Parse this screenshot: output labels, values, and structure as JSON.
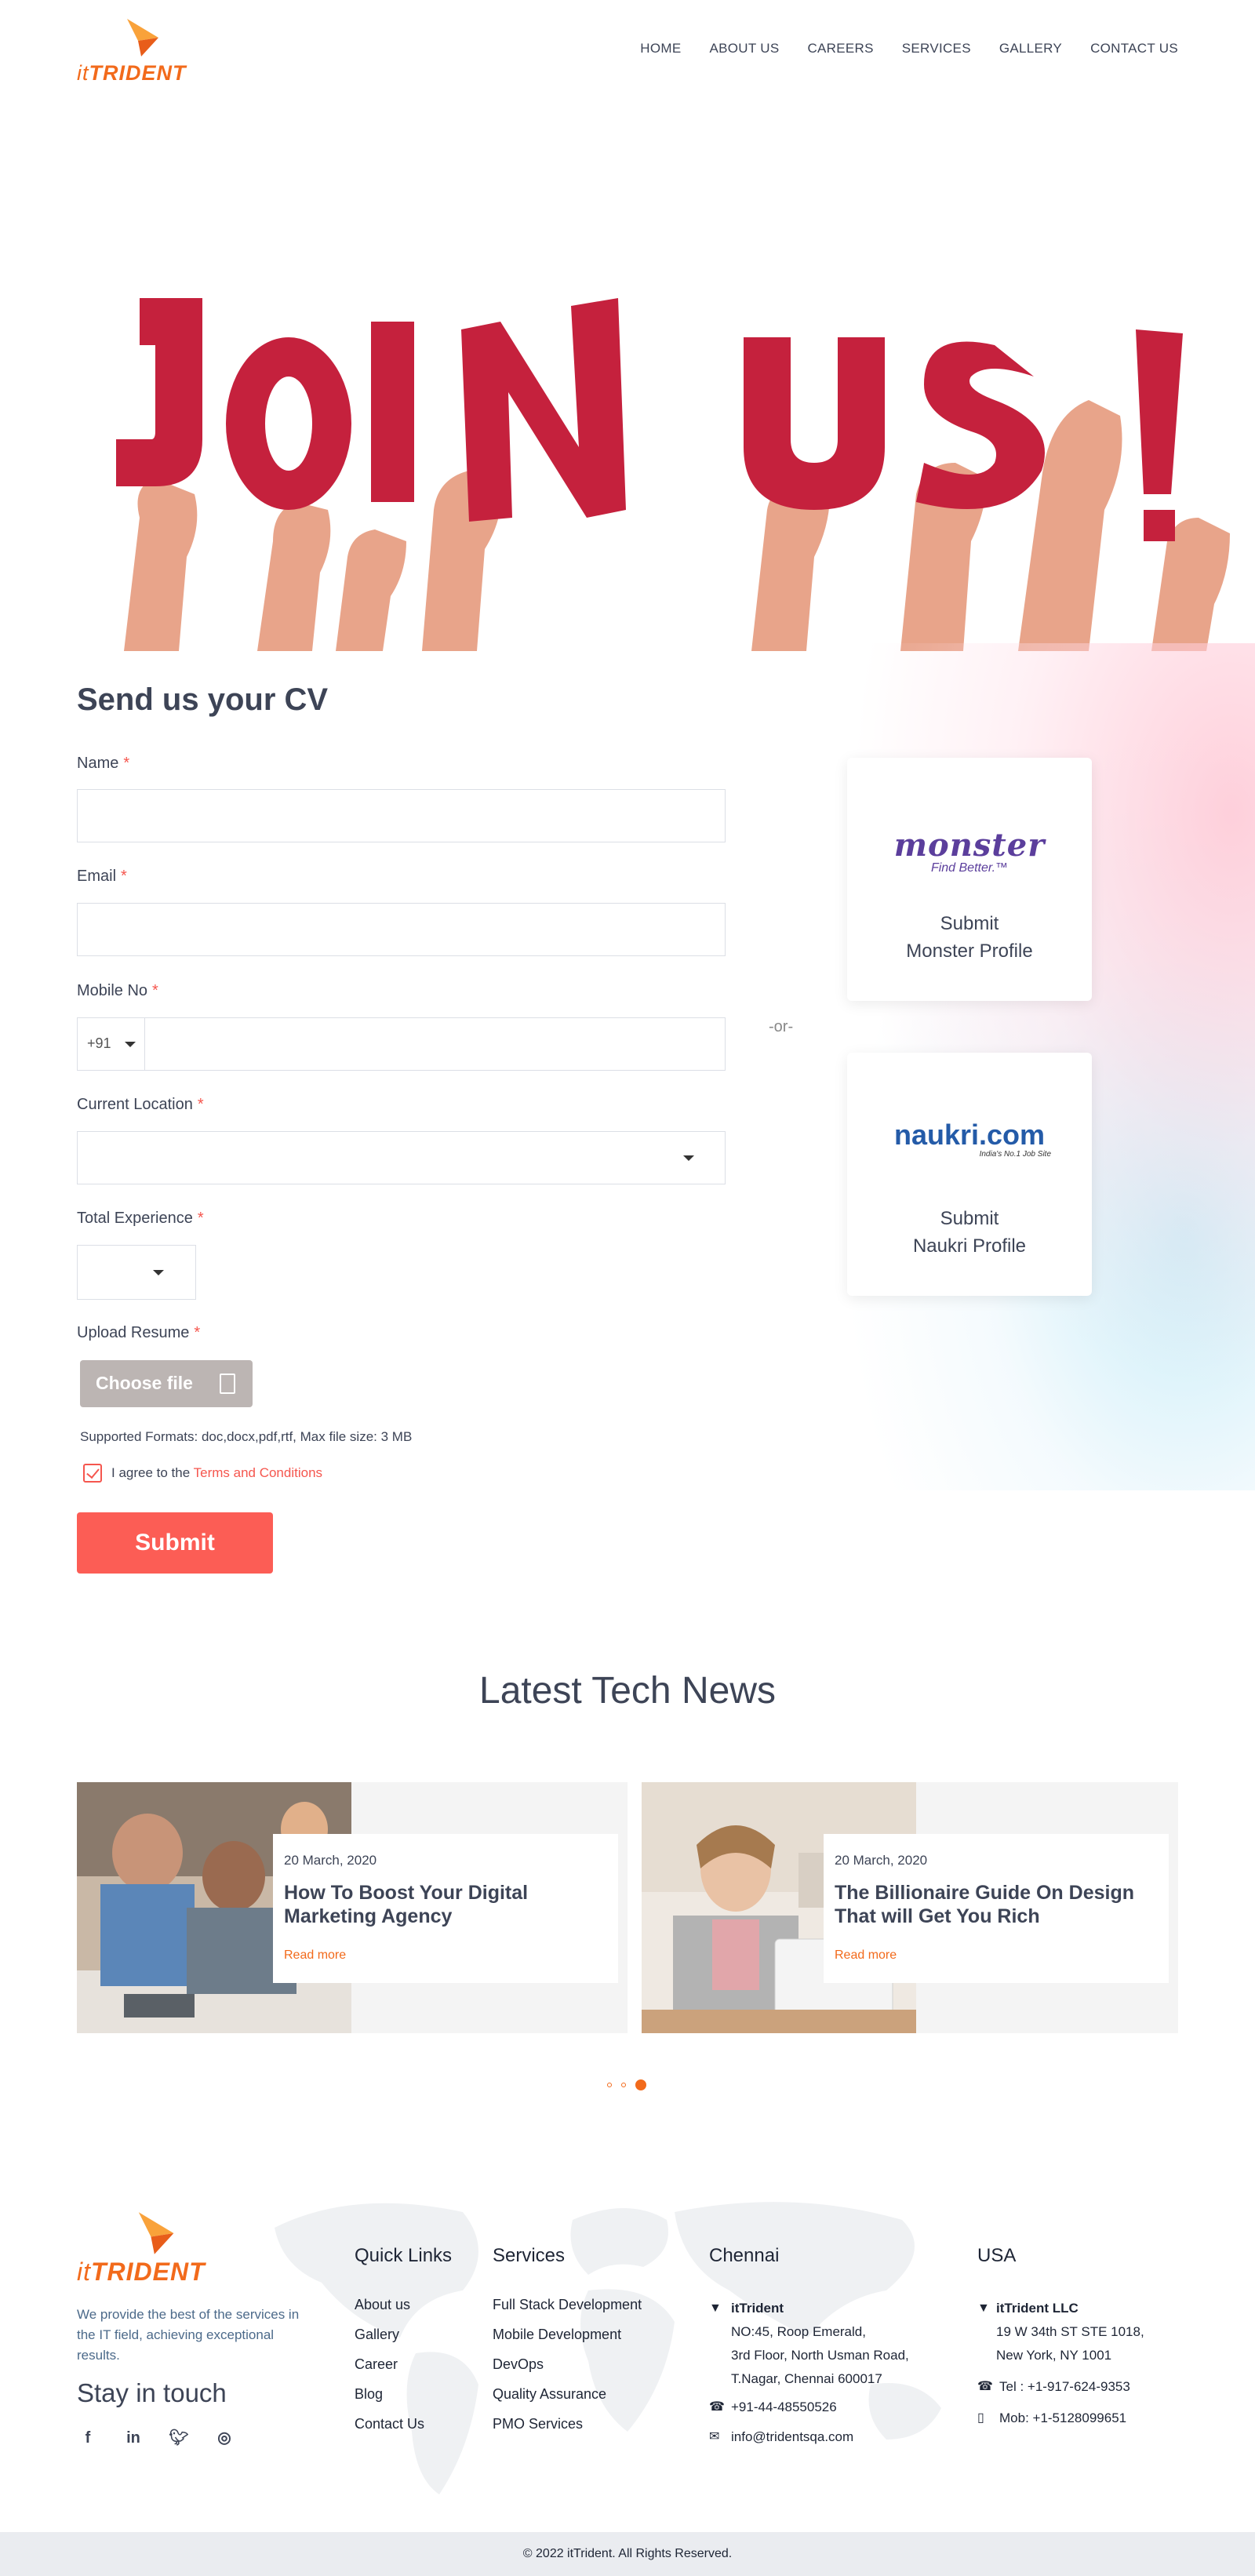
{
  "brand": {
    "logo_it": "it",
    "logo_name": "TRIDENT",
    "accent": "#f26a1b",
    "cta": "#fc5d55"
  },
  "nav": {
    "items": [
      "HOME",
      "ABOUT US",
      "CAREERS",
      "SERVICES",
      "GALLERY",
      "CONTACT US"
    ]
  },
  "hero": {
    "letters": [
      "J",
      "O",
      "I",
      "N",
      "U",
      "S",
      "!"
    ],
    "hand_colors": [
      "#e8a48a",
      "#d98e73"
    ],
    "letter_color": "#c5213d"
  },
  "form": {
    "title": "Send us your CV",
    "name_label": "Name",
    "email_label": "Email",
    "mobile_label": "Mobile No",
    "mobile_code": "+91",
    "location_label": "Current Location",
    "experience_label": "Total Experience",
    "upload_label": "Upload Resume",
    "choose_file": "Choose file",
    "supported": "Supported Formats: doc,docx,pdf,rtf, Max file size: 3 MB",
    "agree_text": "I agree to the",
    "terms_link": "Terms and Conditions",
    "submit": "Submit",
    "required_mark": "*"
  },
  "alternatives": {
    "or": "-or-",
    "monster": {
      "logo": "monster",
      "tagline": "Find Better.™",
      "label_line1": "Submit",
      "label_line2": "Monster Profile"
    },
    "naukri": {
      "logo": "naukri.com",
      "tagline": "India's No.1 Job Site",
      "label_line1": "Submit",
      "label_line2": "Naukri Profile"
    }
  },
  "news": {
    "title": "Latest Tech News",
    "items": [
      {
        "date": "20 March, 2020",
        "headline_line1": "How To Boost Your Digital",
        "headline_line2": "Marketing Agency",
        "more": "Read more"
      },
      {
        "date": "20 March, 2020",
        "headline_line1": "The Billionaire Guide On Design",
        "headline_line2": "That will Get You Rich",
        "more": "Read more"
      }
    ],
    "active_dot": 3,
    "dot_count": 3
  },
  "footer": {
    "description": "We provide the best of the services in the IT field, achieving exceptional results.",
    "stay": "Stay in touch",
    "social_icons": [
      "facebook-icon",
      "linkedin-icon",
      "twitter-icon",
      "instagram-icon"
    ],
    "quick_links_title": "Quick Links",
    "quick_links": [
      "About us",
      "Gallery",
      "Career",
      "Blog",
      "Contact Us"
    ],
    "services_title": "Services",
    "services": [
      "Full Stack Development",
      "Mobile Development",
      "DevOps",
      "Quality Assurance",
      "PMO Services"
    ],
    "chennai": {
      "title": "Chennai",
      "company": "itTrident",
      "address": [
        "NO:45, Roop Emerald,",
        "3rd Floor, North Usman Road,",
        "T.Nagar, Chennai 600017"
      ],
      "phone": "+91-44-48550526",
      "email": "info@tridentsqa.com"
    },
    "usa": {
      "title": "USA",
      "company": "itTrident LLC",
      "address": [
        "19 W 34th ST STE 1018,",
        "New York, NY 1001"
      ],
      "tel": "Tel : +1-917-624-9353",
      "mob": "Mob: +1-5128099651"
    },
    "copyright": "© 2022 itTrident. All Rights Reserved."
  }
}
